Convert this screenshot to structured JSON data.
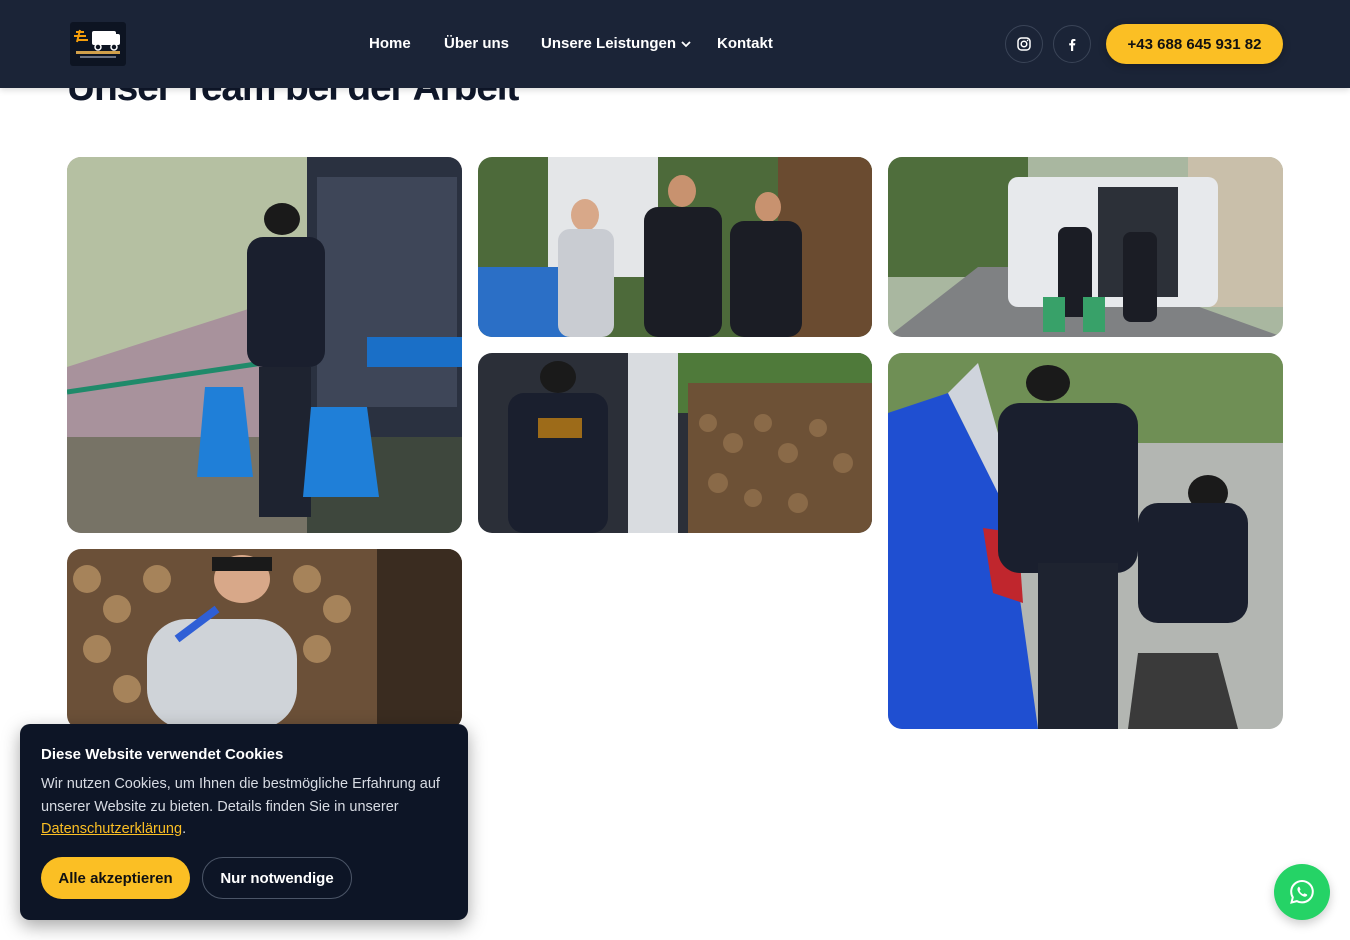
{
  "header": {
    "logo_alt": "RASCH-UMZUG",
    "nav": [
      {
        "label": "Home"
      },
      {
        "label": "Über uns"
      },
      {
        "label": "Unsere Leistungen"
      },
      {
        "label": "Kontakt"
      }
    ],
    "social": [
      {
        "icon": "instagram-icon"
      },
      {
        "icon": "facebook-icon"
      }
    ],
    "phone_label": "+43 688 645 931 82",
    "accent_color": "#fbbf24",
    "background_color": "#1b2437"
  },
  "section": {
    "title": "Unser Team bei der Arbeit"
  },
  "gallery": {
    "images": [
      {
        "description": "team-member-carrying-bags"
      },
      {
        "description": "team-with-customer"
      },
      {
        "description": "team-at-van-street"
      },
      {
        "description": "team-at-van-firewood"
      },
      {
        "description": "team-loading-car"
      },
      {
        "description": "customer-by-firewood"
      }
    ]
  },
  "cookie_banner": {
    "title": "Diese Website verwendet Cookies",
    "text": "Wir nutzen Cookies, um Ihnen die bestmögliche Erfahrung auf unserer Website zu bieten. Details finden Sie in unserer",
    "link_label": "Datenschutzerklärung",
    "link_suffix": ".",
    "accept_label": "Alle akzeptieren",
    "necessary_label": "Nur notwendige"
  },
  "whatsapp": {
    "icon": "whatsapp-icon",
    "color": "#25d366"
  }
}
